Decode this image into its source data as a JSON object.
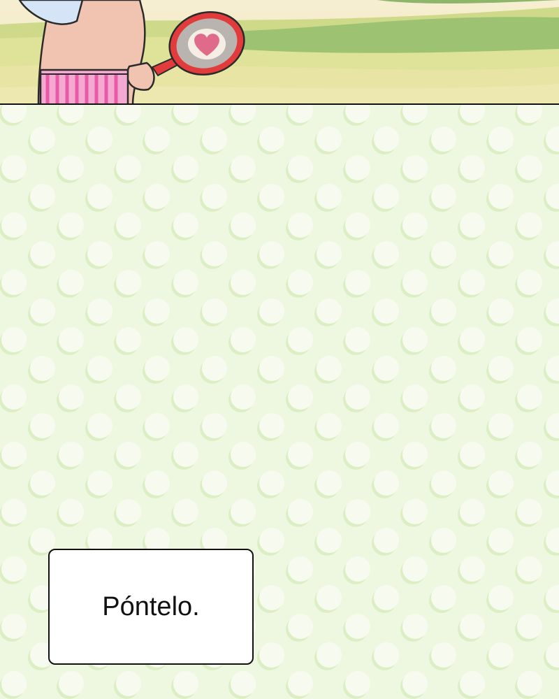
{
  "caption": {
    "text": "Póntelo."
  },
  "colors": {
    "background": "#eef8e0",
    "dot": "#f7fbef",
    "dot_shadow": "#dcefc4",
    "pants_pink": "#e85aa8",
    "pan_red": "#e23b3b",
    "heart": "#e06a8a"
  },
  "scene": {
    "icons": [
      "wing-icon",
      "frying-pan-icon",
      "heart-icon"
    ]
  }
}
